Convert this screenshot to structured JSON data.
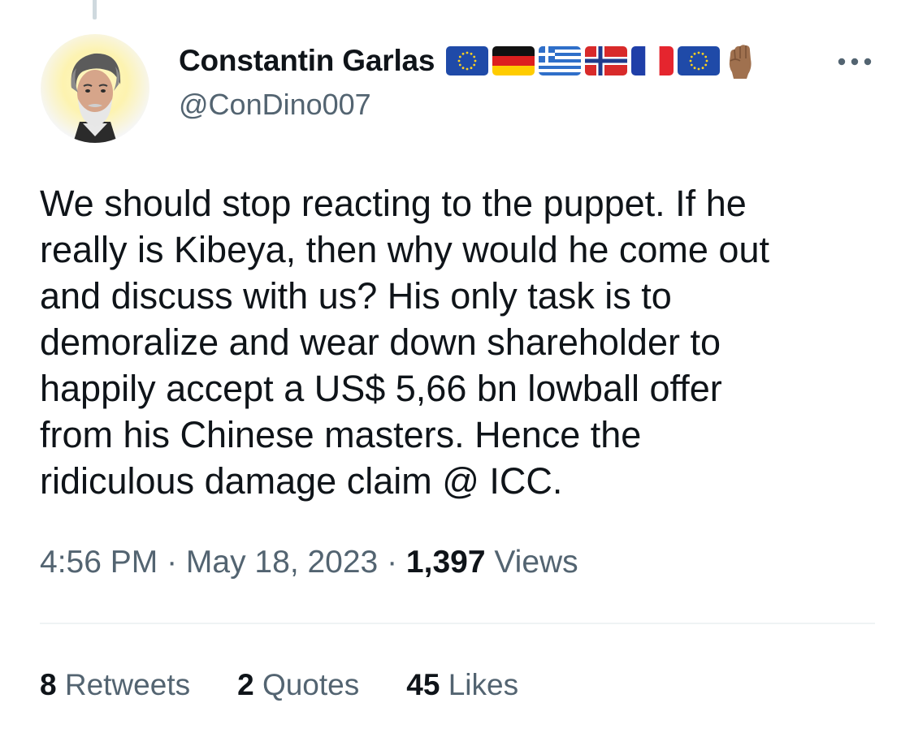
{
  "tweet": {
    "author": {
      "display_name": "Constantin Garlas",
      "handle": "@ConDino007",
      "avatar_icon": "avatar-photo",
      "badges": [
        "eu-flag",
        "germany-flag",
        "greece-flag",
        "norway-flag",
        "france-flag",
        "eu-flag",
        "raised-fist-emoji"
      ]
    },
    "text_lines": [
      "We should stop reacting to the puppet. If he",
      "really is Kibeya, then why would he come out",
      "and discuss with us? His only task is to",
      "demoralize and wear down shareholder to",
      "happily accept a US$ 5,66 bn lowball offer",
      "from his Chinese masters. Hence the",
      "ridiculous damage claim @ ICC."
    ],
    "time": "4:56 PM",
    "separator": "·",
    "date": "May 18, 2023",
    "views_count": "1,397",
    "views_label": "Views",
    "stats": {
      "retweets_count": "8",
      "retweets_label": "Retweets",
      "quotes_count": "2",
      "quotes_label": "Quotes",
      "likes_count": "45",
      "likes_label": "Likes"
    },
    "more_icon": "more-options-icon"
  },
  "colors": {
    "text_primary": "#0f1419",
    "text_secondary": "#536471",
    "divider": "#eff3f4",
    "thread_line": "#cfd9de"
  }
}
